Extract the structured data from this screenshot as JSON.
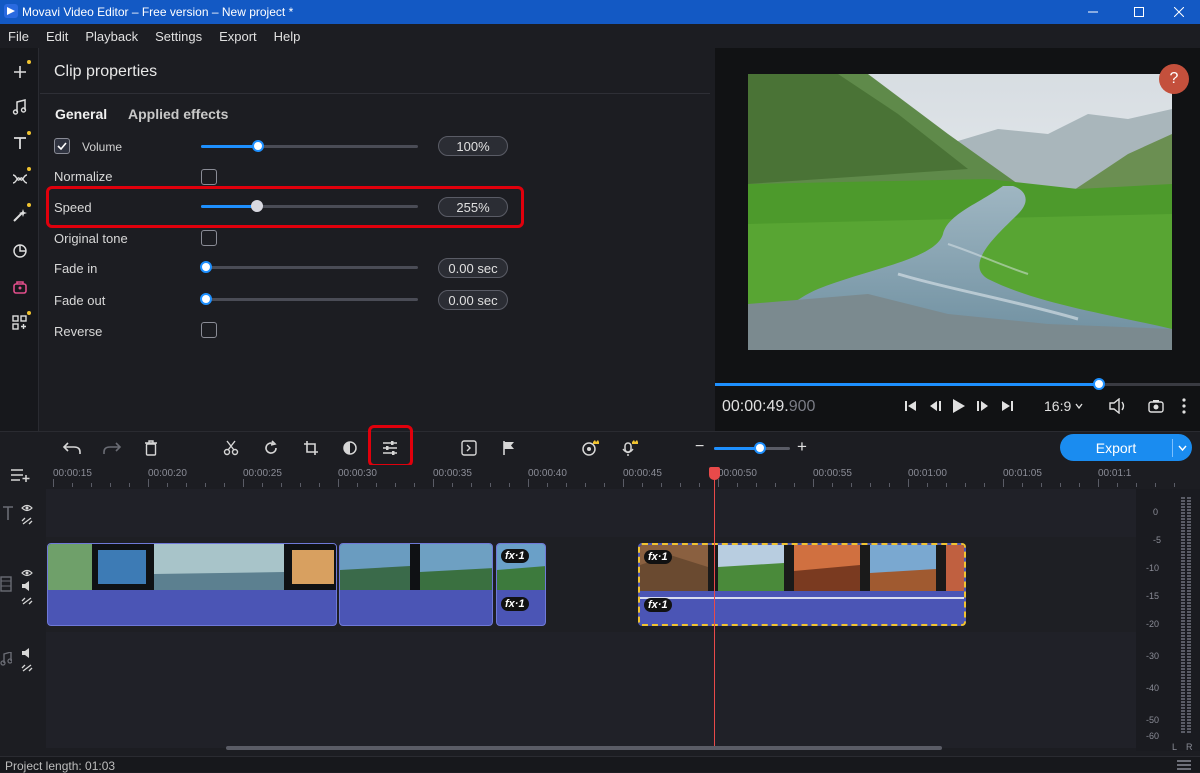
{
  "window": {
    "title": "Movavi Video Editor – Free version – New project *",
    "controls": [
      "minimize-icon",
      "maximize-icon",
      "close-icon"
    ]
  },
  "menu": [
    "File",
    "Edit",
    "Playback",
    "Settings",
    "Export",
    "Help"
  ],
  "left_toolbar": [
    "plus-icon",
    "music-icon",
    "text-icon",
    "transitions-icon",
    "magic-icon",
    "stickers-icon",
    "store-icon",
    "widgets-icon"
  ],
  "properties": {
    "header": "Clip properties",
    "tabs": [
      "General",
      "Applied effects"
    ],
    "volume": {
      "label": "Volume",
      "value": "100%",
      "checked": true,
      "level": 0.27
    },
    "normalize": {
      "label": "Normalize",
      "checked": false
    },
    "speed": {
      "label": "Speed",
      "value": "255%",
      "level": 0.26
    },
    "original_tone": {
      "label": "Original tone",
      "checked": false
    },
    "fade_in": {
      "label": "Fade in",
      "value": "0.00 sec",
      "level": 0
    },
    "fade_out": {
      "label": "Fade out",
      "value": "0.00 sec",
      "level": 0
    },
    "reverse": {
      "label": "Reverse",
      "checked": false
    }
  },
  "preview": {
    "help": "?",
    "timecode_main": "00:00:49.",
    "timecode_ms": "900",
    "progress": 0.79,
    "aspect": "16:9",
    "aspect_icon": "chevron-down-icon"
  },
  "toolbar": {
    "export_label": "Export",
    "zoom_minus": "−",
    "zoom_plus": "+"
  },
  "ruler": [
    "00:00:15",
    "00:00:20",
    "00:00:25",
    "00:00:30",
    "00:00:35",
    "00:00:40",
    "00:00:45",
    "00:00:50",
    "00:00:55",
    "00:01:00",
    "00:01:05",
    "00:01:1"
  ],
  "clips": {
    "fx_label": "fx·1"
  },
  "meter": {
    "labels": [
      "0",
      "-5",
      "-10",
      "-15",
      "-20",
      "-30",
      "-40",
      "-50",
      "-60"
    ],
    "channels": [
      "L",
      "R"
    ]
  },
  "status": {
    "project_length": "Project length: 01:03"
  },
  "colors": {
    "accent": "#1e90ff",
    "highlight": "#e0000c",
    "clip": "#4b55b5",
    "selected_clip_border": "#f0c330",
    "playhead": "#e84a4a"
  }
}
